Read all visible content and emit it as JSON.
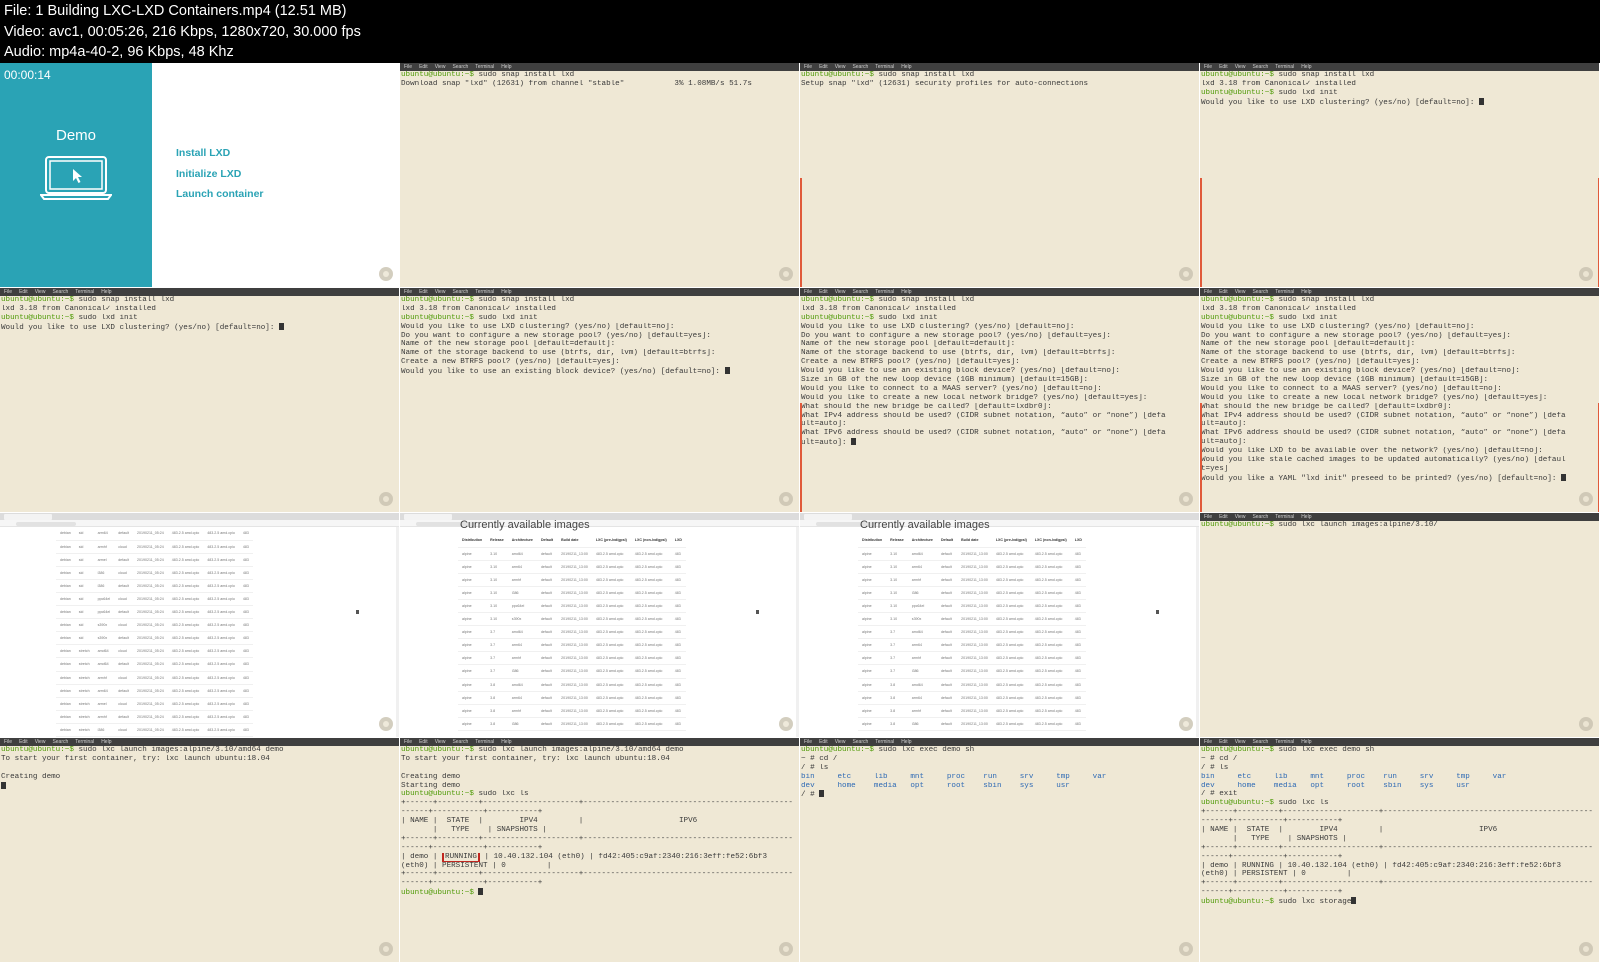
{
  "header": {
    "file": "File: 1  Building LXC-LXD Containers.mp4 (12.51 MB)",
    "video": "Video: avc1, 00:05:26, 216 Kbps, 1280x720, 30.000 fps",
    "audio": "Audio: mp4a-40-2, 96 Kbps, 48 Khz"
  },
  "menubar": [
    "File",
    "Edit",
    "View",
    "Search",
    "Terminal",
    "Help"
  ],
  "demo": {
    "timestamp": "00:00:14",
    "title": "Demo",
    "links": [
      "Install LXD",
      "Initialize LXD",
      "Launch container"
    ]
  },
  "browser": {
    "heading": "Currently available images",
    "columns": [
      "Distribution",
      "Release",
      "Architecture",
      "Default",
      "Build date",
      "LXC (pre-lxd/gpsl)",
      "LXC (non-lxd/gpsl)",
      "LXD"
    ],
    "rows1": [
      [
        "debian",
        "sid",
        "arm64",
        "default",
        "20190211_05:24",
        "483.2.5 amd.cpio",
        "483.2.5 amd.cpio",
        "483"
      ],
      [
        "debian",
        "sid",
        "armhf",
        "cloud",
        "20190211_05:24",
        "483.2.5 amd.cpio",
        "483.2.5 amd.cpio",
        "483"
      ],
      [
        "debian",
        "sid",
        "armel",
        "default",
        "20190211_05:24",
        "483.2.5 amd.cpio",
        "483.2.5 amd.cpio",
        "483"
      ],
      [
        "debian",
        "sid",
        "i386",
        "cloud",
        "20190211_05:24",
        "483.2.5 amd.cpio",
        "483.2.5 amd.cpio",
        "483"
      ],
      [
        "debian",
        "sid",
        "i386",
        "default",
        "20190211_05:24",
        "483.2.5 amd.cpio",
        "483.2.5 amd.cpio",
        "483"
      ],
      [
        "debian",
        "sid",
        "ppc64el",
        "cloud",
        "20190211_05:24",
        "483.2.5 amd.cpio",
        "483.2.5 amd.cpio",
        "483"
      ],
      [
        "debian",
        "sid",
        "ppc64el",
        "default",
        "20190211_05:24",
        "483.2.5 amd.cpio",
        "483.2.5 amd.cpio",
        "483"
      ],
      [
        "debian",
        "sid",
        "s390x",
        "cloud",
        "20190211_05:24",
        "483.2.5 amd.cpio",
        "483.2.5 amd.cpio",
        "483"
      ],
      [
        "debian",
        "sid",
        "s390x",
        "default",
        "20190211_05:24",
        "483.2.5 amd.cpio",
        "483.2.5 amd.cpio",
        "483"
      ],
      [
        "debian",
        "stretch",
        "amd64",
        "cloud",
        "20190211_05:24",
        "483.2.5 amd.cpio",
        "483.2.5 amd.cpio",
        "483"
      ],
      [
        "debian",
        "stretch",
        "amd64",
        "default",
        "20190211_05:24",
        "483.2.5 amd.cpio",
        "483.2.5 amd.cpio",
        "483"
      ],
      [
        "debian",
        "stretch",
        "armhf",
        "cloud",
        "20190211_05:24",
        "483.2.5 amd.cpio",
        "483.2.5 amd.cpio",
        "483"
      ],
      [
        "debian",
        "stretch",
        "arm64",
        "default",
        "20190211_05:24",
        "483.2.5 amd.cpio",
        "483.2.5 amd.cpio",
        "483"
      ],
      [
        "debian",
        "stretch",
        "armel",
        "cloud",
        "20190211_05:24",
        "483.2.5 amd.cpio",
        "483.2.5 amd.cpio",
        "483"
      ],
      [
        "debian",
        "stretch",
        "armhf",
        "default",
        "20190211_05:24",
        "483.2.5 amd.cpio",
        "483.2.5 amd.cpio",
        "483"
      ],
      [
        "debian",
        "stretch",
        "i386",
        "cloud",
        "20190211_05:24",
        "483.2.5 amd.cpio",
        "483.2.5 amd.cpio",
        "483"
      ]
    ],
    "rows2": [
      [
        "alpine",
        "3.10",
        "amd64",
        "default",
        "20190211_13:00",
        "483.2.5 amd.cpio",
        "483.2.5 amd.cpio",
        "483"
      ],
      [
        "alpine",
        "3.10",
        "arm64",
        "default",
        "20190211_13:00",
        "483.2.5 amd.cpio",
        "483.2.5 amd.cpio",
        "483"
      ],
      [
        "alpine",
        "3.10",
        "armhf",
        "default",
        "20190211_13:00",
        "483.2.5 amd.cpio",
        "483.2.5 amd.cpio",
        "483"
      ],
      [
        "alpine",
        "3.10",
        "i386",
        "default",
        "20190211_13:00",
        "483.2.5 amd.cpio",
        "483.2.5 amd.cpio",
        "483"
      ],
      [
        "alpine",
        "3.10",
        "ppc64el",
        "default",
        "20190211_13:00",
        "483.2.5 amd.cpio",
        "483.2.5 amd.cpio",
        "483"
      ],
      [
        "alpine",
        "3.10",
        "s390x",
        "default",
        "20190211_13:00",
        "483.2.5 amd.cpio",
        "483.2.5 amd.cpio",
        "483"
      ],
      [
        "alpine",
        "3.7",
        "amd64",
        "default",
        "20190211_13:00",
        "483.2.5 amd.cpio",
        "483.2.5 amd.cpio",
        "483"
      ],
      [
        "alpine",
        "3.7",
        "arm64",
        "default",
        "20190211_13:00",
        "483.2.5 amd.cpio",
        "483.2.5 amd.cpio",
        "483"
      ],
      [
        "alpine",
        "3.7",
        "armhf",
        "default",
        "20190211_13:00",
        "483.2.5 amd.cpio",
        "483.2.5 amd.cpio",
        "483"
      ],
      [
        "alpine",
        "3.7",
        "i386",
        "default",
        "20190211_13:00",
        "483.2.5 amd.cpio",
        "483.2.5 amd.cpio",
        "483"
      ],
      [
        "alpine",
        "3.8",
        "amd64",
        "default",
        "20190211_13:00",
        "483.2.5 amd.cpio",
        "483.2.5 amd.cpio",
        "483"
      ],
      [
        "alpine",
        "3.8",
        "arm64",
        "default",
        "20190211_13:00",
        "483.2.5 amd.cpio",
        "483.2.5 amd.cpio",
        "483"
      ],
      [
        "alpine",
        "3.8",
        "armhf",
        "default",
        "20190211_13:00",
        "483.2.5 amd.cpio",
        "483.2.5 amd.cpio",
        "483"
      ],
      [
        "alpine",
        "3.8",
        "i386",
        "default",
        "20190211_13:00",
        "483.2.5 amd.cpio",
        "483.2.5 amd.cpio",
        "483"
      ]
    ]
  },
  "tiles": [
    {
      "type": "demo"
    },
    {
      "type": "term",
      "lines": [
        {
          "p": "ubuntu@ubuntu:~$ ",
          "t": "sudo snap install lxd"
        },
        {
          "t": "Download snap \"lxd\" (12631) from channel \"stable\"           3% 1.08MB/s 51.7s"
        }
      ]
    },
    {
      "type": "term",
      "leftline": true,
      "lines": [
        {
          "p": "ubuntu@ubuntu:~$ ",
          "t": "sudo snap install lxd"
        },
        {
          "t": "Setup snap \"lxd\" (12631) security profiles for auto-connections"
        }
      ]
    },
    {
      "type": "term",
      "leftline": true,
      "redline": true,
      "lines": [
        {
          "p": "ubuntu@ubuntu:~$ ",
          "t": "sudo snap install lxd"
        },
        {
          "t": "lxd 3.18 from Canonical✓ installed"
        },
        {
          "p": "ubuntu@ubuntu:~$ ",
          "t": "sudo lxd init"
        },
        {
          "t": "Would you like to use LXD clustering? (yes/no) [default=no]: ",
          "cursor": true
        }
      ]
    },
    {
      "type": "term",
      "lines": [
        {
          "p": "ubuntu@ubuntu:~$ ",
          "t": "sudo snap install lxd"
        },
        {
          "t": "lxd 3.18 from Canonical✓ installed"
        },
        {
          "p": "ubuntu@ubuntu:~$ ",
          "t": "sudo lxd init"
        },
        {
          "t": "Would you like to use LXD clustering? (yes/no) [default=no]: ",
          "cursor": true
        }
      ]
    },
    {
      "type": "term",
      "lines": [
        {
          "p": "ubuntu@ubuntu:~$ ",
          "t": "sudo snap install lxd"
        },
        {
          "t": "lxd 3.18 from Canonical✓ installed"
        },
        {
          "p": "ubuntu@ubuntu:~$ ",
          "t": "sudo lxd init"
        },
        {
          "t": "Would you like to use LXD clustering? (yes/no) [default=no]:"
        },
        {
          "t": "Do you want to configure a new storage pool? (yes/no) [default=yes]:"
        },
        {
          "t": "Name of the new storage pool [default=default]:"
        },
        {
          "t": "Name of the storage backend to use (btrfs, dir, lvm) [default=btrfs]:"
        },
        {
          "t": "Create a new BTRFS pool? (yes/no) [default=yes]:"
        },
        {
          "t": "Would you like to use an existing block device? (yes/no) [default=no]: ",
          "cursor": true
        }
      ]
    },
    {
      "type": "term",
      "leftline": true,
      "lines": [
        {
          "p": "ubuntu@ubuntu:~$ ",
          "t": "sudo snap install lxd"
        },
        {
          "t": "lxd 3.18 from Canonical✓ installed"
        },
        {
          "p": "ubuntu@ubuntu:~$ ",
          "t": "sudo lxd init"
        },
        {
          "t": "Would you like to use LXD clustering? (yes/no) [default=no]:"
        },
        {
          "t": "Do you want to configure a new storage pool? (yes/no) [default=yes]:"
        },
        {
          "t": "Name of the new storage pool [default=default]:"
        },
        {
          "t": "Name of the storage backend to use (btrfs, dir, lvm) [default=btrfs]:"
        },
        {
          "t": "Create a new BTRFS pool? (yes/no) [default=yes]:"
        },
        {
          "t": "Would you like to use an existing block device? (yes/no) [default=no]:"
        },
        {
          "t": "Size in GB of the new loop device (1GB minimum) [default=15GB]:"
        },
        {
          "t": "Would you like to connect to a MAAS server? (yes/no) [default=no]:"
        },
        {
          "t": "Would you like to create a new local network bridge? (yes/no) [default=yes]:"
        },
        {
          "t": "What should the new bridge be called? [default=lxdbr0]:"
        },
        {
          "t": "What IPv4 address should be used? (CIDR subnet notation, “auto” or “none”) [defa"
        },
        {
          "t": "ult=auto]:"
        },
        {
          "t": "What IPv6 address should be used? (CIDR subnet notation, “auto” or “none”) [defa"
        },
        {
          "t": "ult=auto]: ",
          "cursor": true
        }
      ]
    },
    {
      "type": "term",
      "leftline": true,
      "redline": true,
      "lines": [
        {
          "p": "ubuntu@ubuntu:~$ ",
          "t": "sudo snap install lxd"
        },
        {
          "t": "lxd 3.18 from Canonical✓ installed"
        },
        {
          "p": "ubuntu@ubuntu:~$ ",
          "t": "sudo lxd init"
        },
        {
          "t": "Would you like to use LXD clustering? (yes/no) [default=no]:"
        },
        {
          "t": "Do you want to configure a new storage pool? (yes/no) [default=yes]:"
        },
        {
          "t": "Name of the new storage pool [default=default]:"
        },
        {
          "t": "Name of the storage backend to use (btrfs, dir, lvm) [default=btrfs]:"
        },
        {
          "t": "Create a new BTRFS pool? (yes/no) [default=yes]:"
        },
        {
          "t": "Would you like to use an existing block device? (yes/no) [default=no]:"
        },
        {
          "t": "Size in GB of the new loop device (1GB minimum) [default=15GB]:"
        },
        {
          "t": "Would you like to connect to a MAAS server? (yes/no) [default=no]:"
        },
        {
          "t": "Would you like to create a new local network bridge? (yes/no) [default=yes]:"
        },
        {
          "t": "What should the new bridge be called? [default=lxdbr0]:"
        },
        {
          "t": "What IPv4 address should be used? (CIDR subnet notation, “auto” or “none”) [defa"
        },
        {
          "t": "ult=auto]:"
        },
        {
          "t": "What IPv6 address should be used? (CIDR subnet notation, “auto” or “none”) [defa"
        },
        {
          "t": "ult=auto]:"
        },
        {
          "t": "Would you like LXD to be available over the network? (yes/no) [default=no]:"
        },
        {
          "t": "Would you like stale cached images to be updated automatically? (yes/no) [defaul"
        },
        {
          "t": "t=yes]"
        },
        {
          "t": "Would you like a YAML \"lxd init\" preseed to be printed? (yes/no) [default=no]: ",
          "cursor": true
        }
      ]
    },
    {
      "type": "browser",
      "rowsKey": "rows1",
      "showHeading": false,
      "mouse": [
        356,
        97
      ]
    },
    {
      "type": "browser",
      "rowsKey": "rows2",
      "showHeading": true,
      "mouse": [
        356,
        97
      ]
    },
    {
      "type": "browser",
      "rowsKey": "rows2",
      "showHeading": true,
      "mouse": [
        356,
        97
      ]
    },
    {
      "type": "term",
      "lines": [
        {
          "p": "ubuntu@ubuntu:~$ ",
          "t": "sudo lxc launch images:alpine/3.10/"
        }
      ]
    },
    {
      "type": "term",
      "lines": [
        {
          "p": "ubuntu@ubuntu:~$ ",
          "t": "sudo lxc launch images:alpine/3.10/amd64 demo"
        },
        {
          "t": "To start your first container, try: lxc launch ubuntu:18.04"
        },
        {
          "t": ""
        },
        {
          "t": "Creating demo"
        },
        {
          "t": "",
          "cursor": true
        }
      ]
    },
    {
      "type": "term",
      "lines": [
        {
          "p": "ubuntu@ubuntu:~$ ",
          "t": "sudo lxc launch images:alpine/3.10/amd64 demo"
        },
        {
          "t": "To start your first container, try: lxc launch ubuntu:18.04"
        },
        {
          "t": ""
        },
        {
          "t": "Creating demo"
        },
        {
          "t": "Starting demo"
        },
        {
          "p": "ubuntu@ubuntu:~$ ",
          "t": "sudo lxc ls"
        },
        {
          "t": "+------+---------+---------------------+----------------------------------------------"
        },
        {
          "t": "------+-----------+-----------+"
        },
        {
          "t": "| NAME |  STATE  |        IPV4         |                     IPV6"
        },
        {
          "t": "       |   TYPE    | SNAPSHOTS |"
        },
        {
          "t": "+------+---------+---------------------+----------------------------------------------"
        },
        {
          "t": "------+-----------+-----------+"
        },
        {
          "t": "| demo | ",
          "box": "RUNNING",
          "t2": " | 10.40.132.104 (eth0) | fd42:405:c9af:2340:216:3eff:fe52:6bf3"
        },
        {
          "t": "(eth0) | PERSISTENT | 0         |"
        },
        {
          "t": "+------+---------+---------------------+----------------------------------------------"
        },
        {
          "t": "------+-----------+-----------+"
        },
        {
          "p": "ubuntu@ubuntu:~$ ",
          "t": "",
          "cursor": true
        }
      ]
    },
    {
      "type": "term",
      "lines": [
        {
          "p": "ubuntu@ubuntu:~$ ",
          "t": "sudo lxc exec demo sh"
        },
        {
          "t": "~ # cd /"
        },
        {
          "t": "/ # ls"
        },
        {
          "ls": "bin     etc     lib     mnt     proc    run     srv     tmp     var"
        },
        {
          "ls": "dev     home    media   opt     root    sbin    sys     usr"
        },
        {
          "t": "/ # ",
          "cursor": true
        }
      ]
    },
    {
      "type": "term",
      "lines": [
        {
          "p": "ubuntu@ubuntu:~$ ",
          "t": "sudo lxc exec demo sh"
        },
        {
          "t": "~ # cd /"
        },
        {
          "t": "/ # ls"
        },
        {
          "ls": "bin     etc     lib     mnt     proc    run     srv     tmp     var"
        },
        {
          "ls": "dev     home    media   opt     root    sbin    sys     usr"
        },
        {
          "t": "/ # exit"
        },
        {
          "p": "ubuntu@ubuntu:~$ ",
          "t": "sudo lxc ls"
        },
        {
          "t": "+------+---------+---------------------+----------------------------------------------"
        },
        {
          "t": "------+-----------+-----------+"
        },
        {
          "t": "| NAME |  STATE  |        IPV4         |                     IPV6"
        },
        {
          "t": "       |   TYPE    | SNAPSHOTS |"
        },
        {
          "t": "+------+---------+---------------------+----------------------------------------------"
        },
        {
          "t": "------+-----------+-----------+"
        },
        {
          "t": "| demo | RUNNING | 10.40.132.104 (eth0) | fd42:405:c9af:2340:216:3eff:fe52:6bf3"
        },
        {
          "t": "(eth0) | PERSISTENT | 0         |"
        },
        {
          "t": "+------+---------+---------------------+----------------------------------------------"
        },
        {
          "t": "------+-----------+-----------+"
        },
        {
          "p": "ubuntu@ubuntu:~$ ",
          "t": "sudo lxc storage",
          "cursor": true
        }
      ]
    }
  ]
}
